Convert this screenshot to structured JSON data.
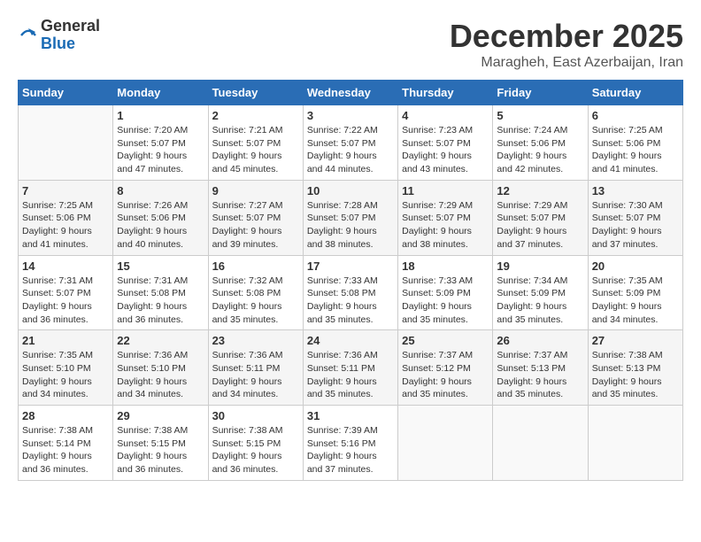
{
  "logo": {
    "general": "General",
    "blue": "Blue"
  },
  "title": {
    "month": "December 2025",
    "location": "Maragheh, East Azerbaijan, Iran"
  },
  "days_of_week": [
    "Sunday",
    "Monday",
    "Tuesday",
    "Wednesday",
    "Thursday",
    "Friday",
    "Saturday"
  ],
  "weeks": [
    [
      {
        "day": "",
        "info": ""
      },
      {
        "day": "1",
        "info": "Sunrise: 7:20 AM\nSunset: 5:07 PM\nDaylight: 9 hours\nand 47 minutes."
      },
      {
        "day": "2",
        "info": "Sunrise: 7:21 AM\nSunset: 5:07 PM\nDaylight: 9 hours\nand 45 minutes."
      },
      {
        "day": "3",
        "info": "Sunrise: 7:22 AM\nSunset: 5:07 PM\nDaylight: 9 hours\nand 44 minutes."
      },
      {
        "day": "4",
        "info": "Sunrise: 7:23 AM\nSunset: 5:07 PM\nDaylight: 9 hours\nand 43 minutes."
      },
      {
        "day": "5",
        "info": "Sunrise: 7:24 AM\nSunset: 5:06 PM\nDaylight: 9 hours\nand 42 minutes."
      },
      {
        "day": "6",
        "info": "Sunrise: 7:25 AM\nSunset: 5:06 PM\nDaylight: 9 hours\nand 41 minutes."
      }
    ],
    [
      {
        "day": "7",
        "info": "Sunrise: 7:25 AM\nSunset: 5:06 PM\nDaylight: 9 hours\nand 41 minutes."
      },
      {
        "day": "8",
        "info": "Sunrise: 7:26 AM\nSunset: 5:06 PM\nDaylight: 9 hours\nand 40 minutes."
      },
      {
        "day": "9",
        "info": "Sunrise: 7:27 AM\nSunset: 5:07 PM\nDaylight: 9 hours\nand 39 minutes."
      },
      {
        "day": "10",
        "info": "Sunrise: 7:28 AM\nSunset: 5:07 PM\nDaylight: 9 hours\nand 38 minutes."
      },
      {
        "day": "11",
        "info": "Sunrise: 7:29 AM\nSunset: 5:07 PM\nDaylight: 9 hours\nand 38 minutes."
      },
      {
        "day": "12",
        "info": "Sunrise: 7:29 AM\nSunset: 5:07 PM\nDaylight: 9 hours\nand 37 minutes."
      },
      {
        "day": "13",
        "info": "Sunrise: 7:30 AM\nSunset: 5:07 PM\nDaylight: 9 hours\nand 37 minutes."
      }
    ],
    [
      {
        "day": "14",
        "info": "Sunrise: 7:31 AM\nSunset: 5:07 PM\nDaylight: 9 hours\nand 36 minutes."
      },
      {
        "day": "15",
        "info": "Sunrise: 7:31 AM\nSunset: 5:08 PM\nDaylight: 9 hours\nand 36 minutes."
      },
      {
        "day": "16",
        "info": "Sunrise: 7:32 AM\nSunset: 5:08 PM\nDaylight: 9 hours\nand 35 minutes."
      },
      {
        "day": "17",
        "info": "Sunrise: 7:33 AM\nSunset: 5:08 PM\nDaylight: 9 hours\nand 35 minutes."
      },
      {
        "day": "18",
        "info": "Sunrise: 7:33 AM\nSunset: 5:09 PM\nDaylight: 9 hours\nand 35 minutes."
      },
      {
        "day": "19",
        "info": "Sunrise: 7:34 AM\nSunset: 5:09 PM\nDaylight: 9 hours\nand 35 minutes."
      },
      {
        "day": "20",
        "info": "Sunrise: 7:35 AM\nSunset: 5:09 PM\nDaylight: 9 hours\nand 34 minutes."
      }
    ],
    [
      {
        "day": "21",
        "info": "Sunrise: 7:35 AM\nSunset: 5:10 PM\nDaylight: 9 hours\nand 34 minutes."
      },
      {
        "day": "22",
        "info": "Sunrise: 7:36 AM\nSunset: 5:10 PM\nDaylight: 9 hours\nand 34 minutes."
      },
      {
        "day": "23",
        "info": "Sunrise: 7:36 AM\nSunset: 5:11 PM\nDaylight: 9 hours\nand 34 minutes."
      },
      {
        "day": "24",
        "info": "Sunrise: 7:36 AM\nSunset: 5:11 PM\nDaylight: 9 hours\nand 35 minutes."
      },
      {
        "day": "25",
        "info": "Sunrise: 7:37 AM\nSunset: 5:12 PM\nDaylight: 9 hours\nand 35 minutes."
      },
      {
        "day": "26",
        "info": "Sunrise: 7:37 AM\nSunset: 5:13 PM\nDaylight: 9 hours\nand 35 minutes."
      },
      {
        "day": "27",
        "info": "Sunrise: 7:38 AM\nSunset: 5:13 PM\nDaylight: 9 hours\nand 35 minutes."
      }
    ],
    [
      {
        "day": "28",
        "info": "Sunrise: 7:38 AM\nSunset: 5:14 PM\nDaylight: 9 hours\nand 36 minutes."
      },
      {
        "day": "29",
        "info": "Sunrise: 7:38 AM\nSunset: 5:15 PM\nDaylight: 9 hours\nand 36 minutes."
      },
      {
        "day": "30",
        "info": "Sunrise: 7:38 AM\nSunset: 5:15 PM\nDaylight: 9 hours\nand 36 minutes."
      },
      {
        "day": "31",
        "info": "Sunrise: 7:39 AM\nSunset: 5:16 PM\nDaylight: 9 hours\nand 37 minutes."
      },
      {
        "day": "",
        "info": ""
      },
      {
        "day": "",
        "info": ""
      },
      {
        "day": "",
        "info": ""
      }
    ]
  ]
}
